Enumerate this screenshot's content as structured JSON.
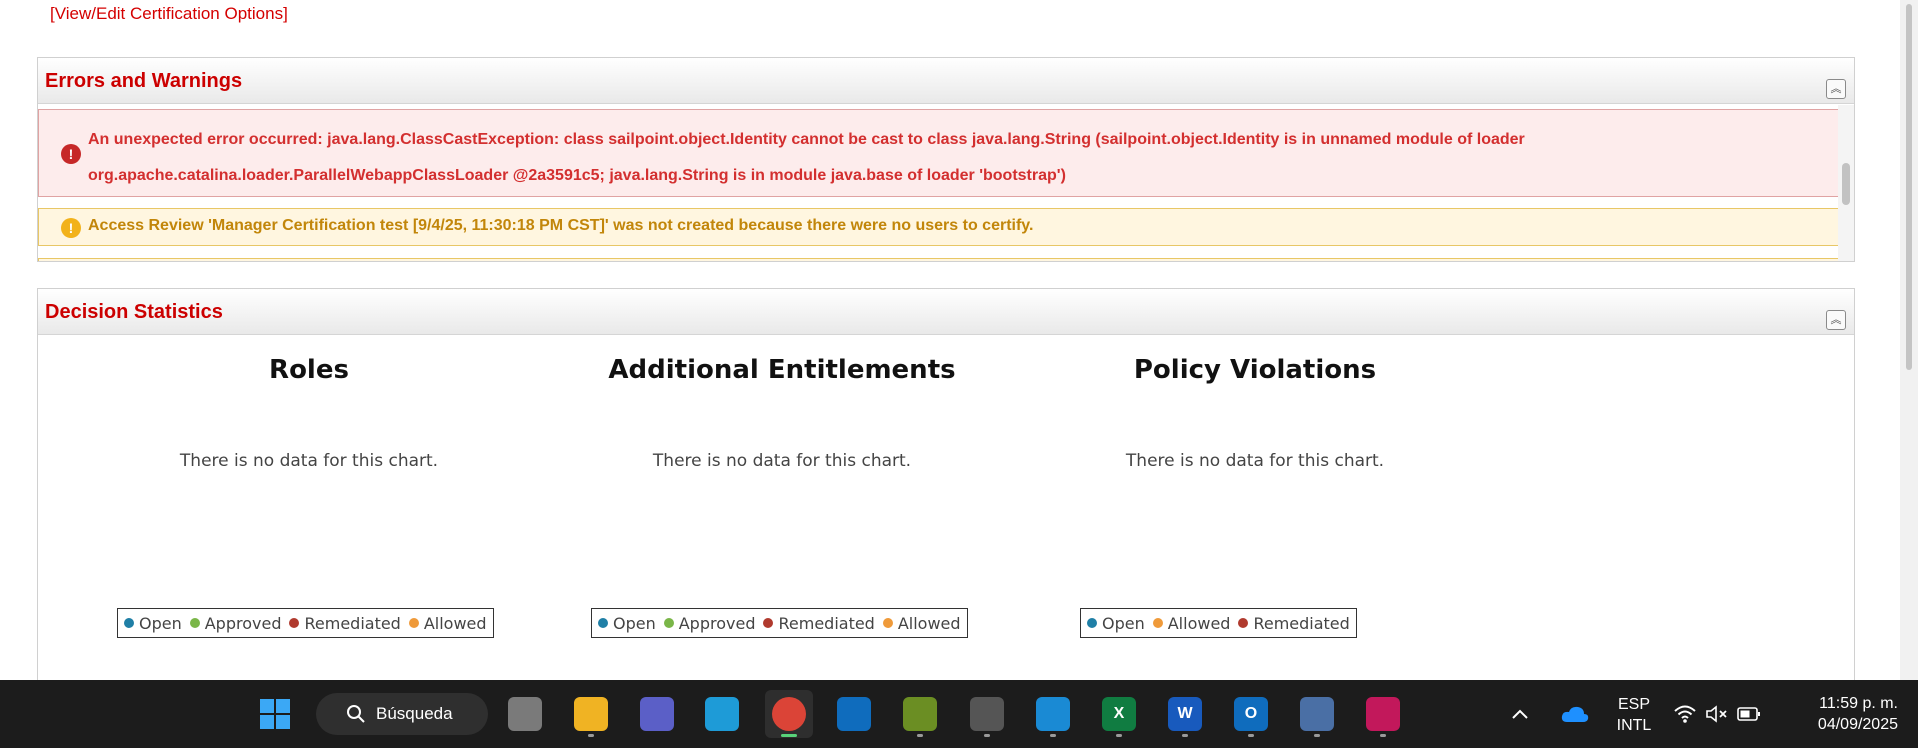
{
  "top_link": "[View/Edit Certification Options]",
  "errors_panel": {
    "title": "Errors and Warnings",
    "error_message": "An unexpected error occurred: java.lang.ClassCastException: class sailpoint.object.Identity cannot be cast to class java.lang.String (sailpoint.object.Identity is in unnamed module of loader org.apache.catalina.loader.ParallelWebappClassLoader @2a3591c5; java.lang.String is in module java.base of loader 'bootstrap')",
    "warning_message": "Access Review 'Manager Certification test [9/4/25, 11:30:18 PM CST]' was not created because there were no users to certify."
  },
  "decision_panel": {
    "title": "Decision Statistics",
    "charts": [
      {
        "title": "Roles",
        "empty_text": "There is no data for this chart.",
        "legend": [
          {
            "label": "Open",
            "color": "#1f7fa6"
          },
          {
            "label": "Approved",
            "color": "#7ab648"
          },
          {
            "label": "Remediated",
            "color": "#b03a2e"
          },
          {
            "label": "Allowed",
            "color": "#ef9a3a"
          }
        ]
      },
      {
        "title": "Additional Entitlements",
        "empty_text": "There is no data for this chart.",
        "legend": [
          {
            "label": "Open",
            "color": "#1f7fa6"
          },
          {
            "label": "Approved",
            "color": "#7ab648"
          },
          {
            "label": "Remediated",
            "color": "#b03a2e"
          },
          {
            "label": "Allowed",
            "color": "#ef9a3a"
          }
        ]
      },
      {
        "title": "Policy Violations",
        "empty_text": "There is no data for this chart.",
        "legend": [
          {
            "label": "Open",
            "color": "#1f7fa6"
          },
          {
            "label": "Allowed",
            "color": "#ef9a3a"
          },
          {
            "label": "Remediated",
            "color": "#b03a2e"
          }
        ]
      }
    ]
  },
  "taskbar": {
    "search_label": "Búsqueda",
    "apps": [
      {
        "name": "windows-start-icon",
        "color": "#3aa0f0",
        "label": ""
      },
      {
        "name": "task-view-icon",
        "color": "#7a7a7a",
        "label": ""
      },
      {
        "name": "file-explorer-icon",
        "color": "#f0b323",
        "label": ""
      },
      {
        "name": "teams-icon",
        "color": "#5b5fc7",
        "label": ""
      },
      {
        "name": "edge-icon",
        "color": "#1e9bd7",
        "label": ""
      },
      {
        "name": "chrome-icon",
        "color": "#db4437",
        "label": ""
      },
      {
        "name": "outlook-icon",
        "color": "#0f6cbd",
        "label": ""
      },
      {
        "name": "notepad-icon",
        "color": "#6b8e23",
        "label": ""
      },
      {
        "name": "settings-app-icon",
        "color": "#555555",
        "label": ""
      },
      {
        "name": "vscode-icon",
        "color": "#1a8ad4",
        "label": ""
      },
      {
        "name": "excel-icon",
        "color": "#107c41",
        "label": "X"
      },
      {
        "name": "word-icon",
        "color": "#185abd",
        "label": "W"
      },
      {
        "name": "outlook-new-icon",
        "color": "#0f6cbd",
        "label": "O"
      },
      {
        "name": "network-tool-icon",
        "color": "#4a6fa5",
        "label": ""
      },
      {
        "name": "snipping-tool-icon",
        "color": "#c2185b",
        "label": ""
      }
    ],
    "tray": {
      "language": "ESP",
      "layout": "INTL",
      "time": "11:59 p. m.",
      "date": "04/09/2025"
    }
  }
}
